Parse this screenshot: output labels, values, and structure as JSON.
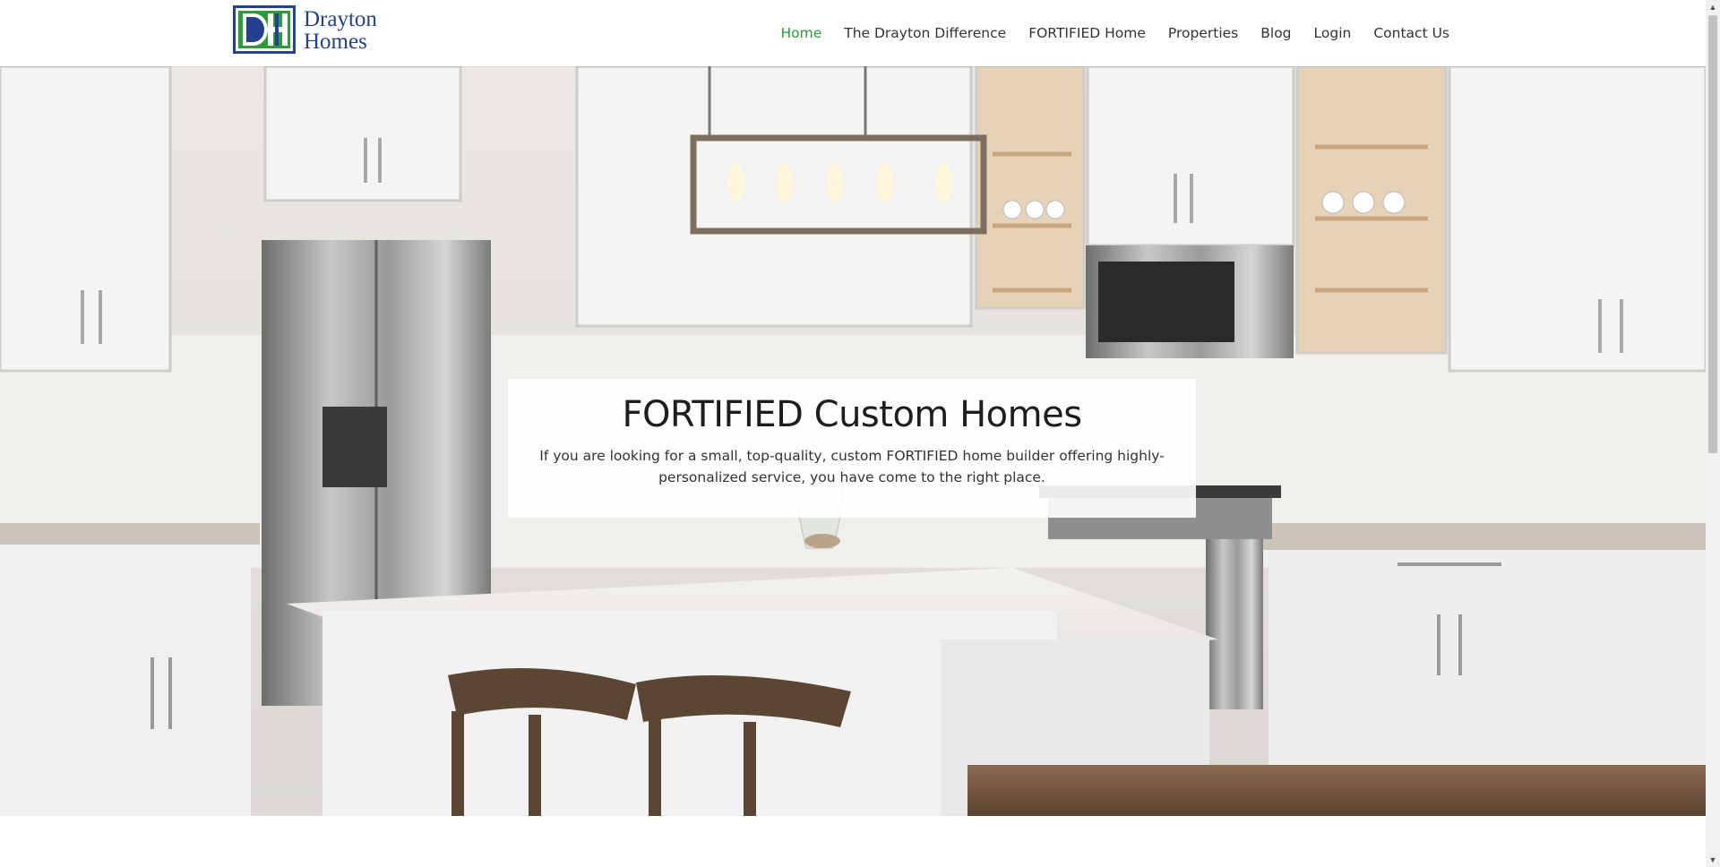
{
  "brand": {
    "line1": "Drayton",
    "line2": "Homes",
    "color": "#24418f",
    "accent": "#2e9b3a"
  },
  "nav": {
    "items": [
      {
        "label": "Home",
        "active": true
      },
      {
        "label": "The Drayton Difference"
      },
      {
        "label": "FORTIFIED Home"
      },
      {
        "label": "Properties"
      },
      {
        "label": "Blog"
      },
      {
        "label": "Login"
      },
      {
        "label": "Contact Us"
      }
    ],
    "active_color": "#2e9b3a"
  },
  "hero": {
    "title": "FORTIFIED Custom Homes",
    "text": "If you are looking for a small, top-quality, custom FORTIFIED home builder offering highly-personalized service, you have come to the right place.",
    "image": "kitchen-photo"
  },
  "icons": {
    "scroll_up": "▲",
    "scroll_down": "▼"
  }
}
